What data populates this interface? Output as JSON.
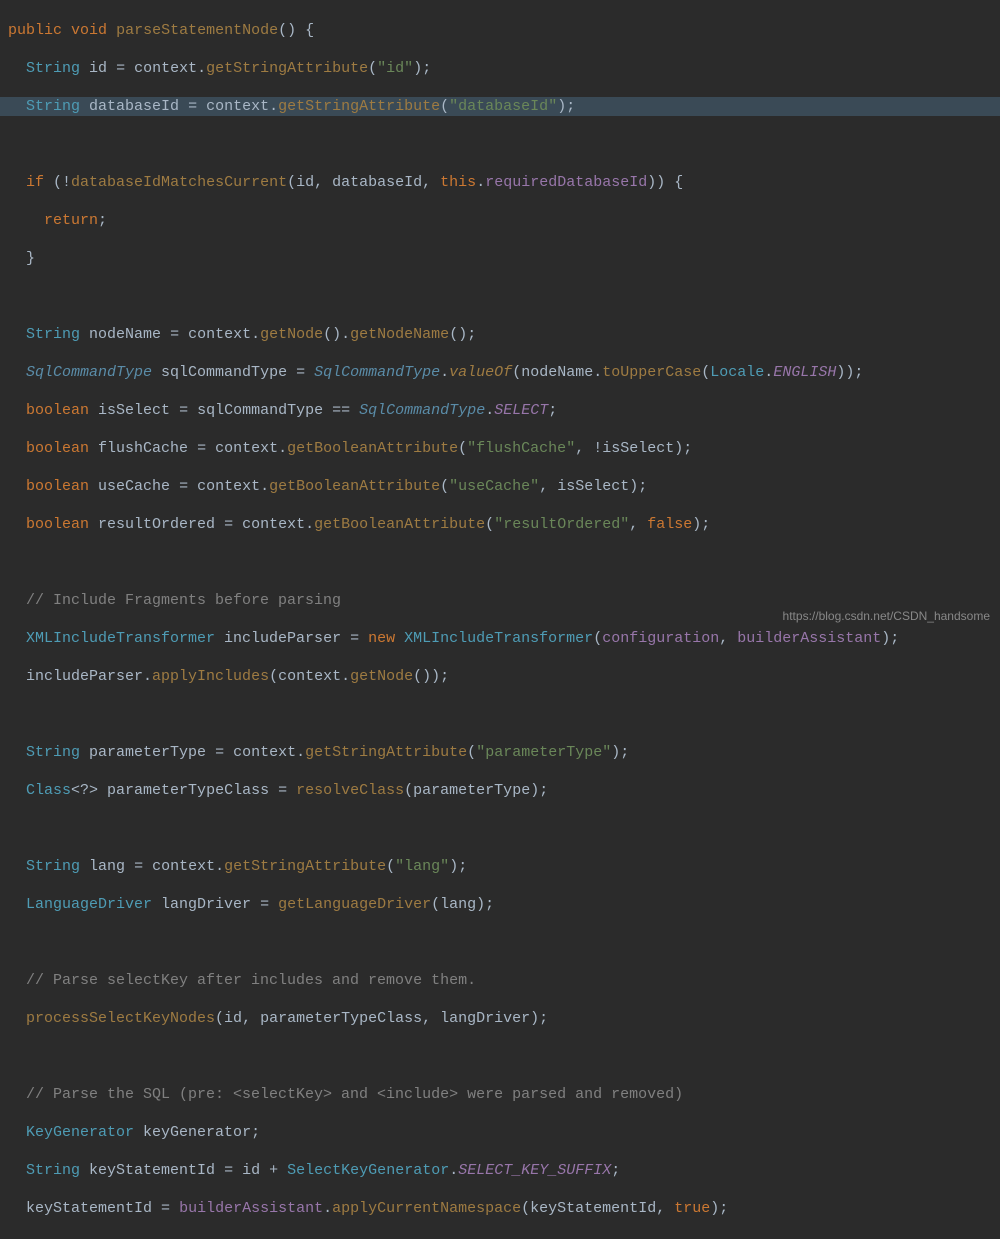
{
  "watermark": "https://blog.csdn.net/CSDN_handsome",
  "syntax": {
    "kw_public": "public",
    "kw_void": "void",
    "kw_if": "if",
    "kw_return": "return",
    "kw_this": "this",
    "kw_new": "new",
    "kw_false": "false",
    "kw_true": "true",
    "kw_boolean": "boolean"
  },
  "types": {
    "String": "String",
    "SqlCommandType": "SqlCommandType",
    "XMLIncludeTransformer": "XMLIncludeTransformer",
    "Class": "Class",
    "LanguageDriver": "LanguageDriver",
    "KeyGenerator": "KeyGenerator",
    "Locale": "Locale",
    "SelectKeyGenerator": "SelectKeyGenerator"
  },
  "methods": {
    "parseStatementNode": "parseStatementNode",
    "getStringAttribute": "getStringAttribute",
    "databaseIdMatchesCurrent": "databaseIdMatchesCurrent",
    "getNode": "getNode",
    "getNodeName": "getNodeName",
    "valueOf": "valueOf",
    "toUpperCase": "toUpperCase",
    "getBooleanAttribute": "getBooleanAttribute",
    "applyIncludes": "applyIncludes",
    "resolveClass": "resolveClass",
    "getLanguageDriver": "getLanguageDriver",
    "processSelectKeyNodes": "processSelectKeyNodes",
    "applyCurrentNamespace": "applyCurrentNamespace"
  },
  "vars": {
    "id": "id",
    "databaseId": "databaseId",
    "context": "context",
    "requiredDatabaseId": "requiredDatabaseId",
    "nodeName": "nodeName",
    "sqlCommandType": "sqlCommandType",
    "isSelect": "isSelect",
    "flushCache": "flushCache",
    "useCache": "useCache",
    "resultOrdered": "resultOrdered",
    "includeParser": "includeParser",
    "configuration": "configuration",
    "builderAssistant": "builderAssistant",
    "parameterType": "parameterType",
    "parameterTypeClass": "parameterTypeClass",
    "lang": "lang",
    "langDriver": "langDriver",
    "keyGenerator": "keyGenerator",
    "keyStatementId": "keyStatementId"
  },
  "constants": {
    "SELECT": "SELECT",
    "ENGLISH": "ENGLISH",
    "SELECT_KEY_SUFFIX": "SELECT_KEY_SUFFIX"
  },
  "strings": {
    "id": "\"id\"",
    "databaseId": "\"databaseId\"",
    "flushCache": "\"flushCache\"",
    "useCache": "\"useCache\"",
    "resultOrdered": "\"resultOrdered\"",
    "parameterType": "\"parameterType\"",
    "lang": "\"lang\""
  },
  "comments": {
    "include": "// Include Fragments before parsing",
    "selectKey": "// Parse selectKey after includes and remove them.",
    "parseSql": "// Parse the SQL (pre: <selectKey> and <include> were parsed and removed)"
  }
}
